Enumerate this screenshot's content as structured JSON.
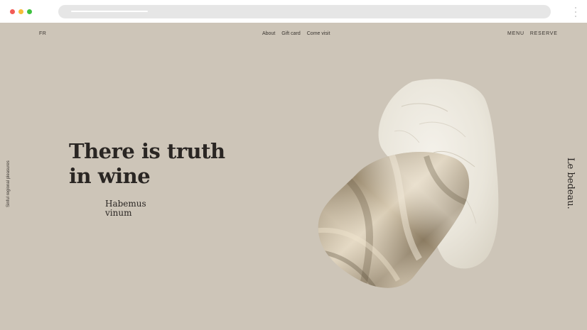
{
  "nav": {
    "lang": "FR",
    "links": [
      "About",
      "Gift card",
      "Come visit"
    ],
    "right": [
      "MENU",
      "RESERVE"
    ]
  },
  "hero": {
    "headline_lines": [
      "There is truth",
      "in wine"
    ],
    "sub_lines": [
      "Habemus",
      "vinum"
    ]
  },
  "side": {
    "left_text": "Sinful regional pleasures",
    "brand": "Le bedeau."
  },
  "colors": {
    "background": "#cdc5b8",
    "text": "#2a2623",
    "stone": "#ece8dd",
    "silk": "#b7a88f",
    "dot_red": "#f25b57",
    "dot_yellow": "#f6bd3a",
    "dot_green": "#3ec140"
  }
}
